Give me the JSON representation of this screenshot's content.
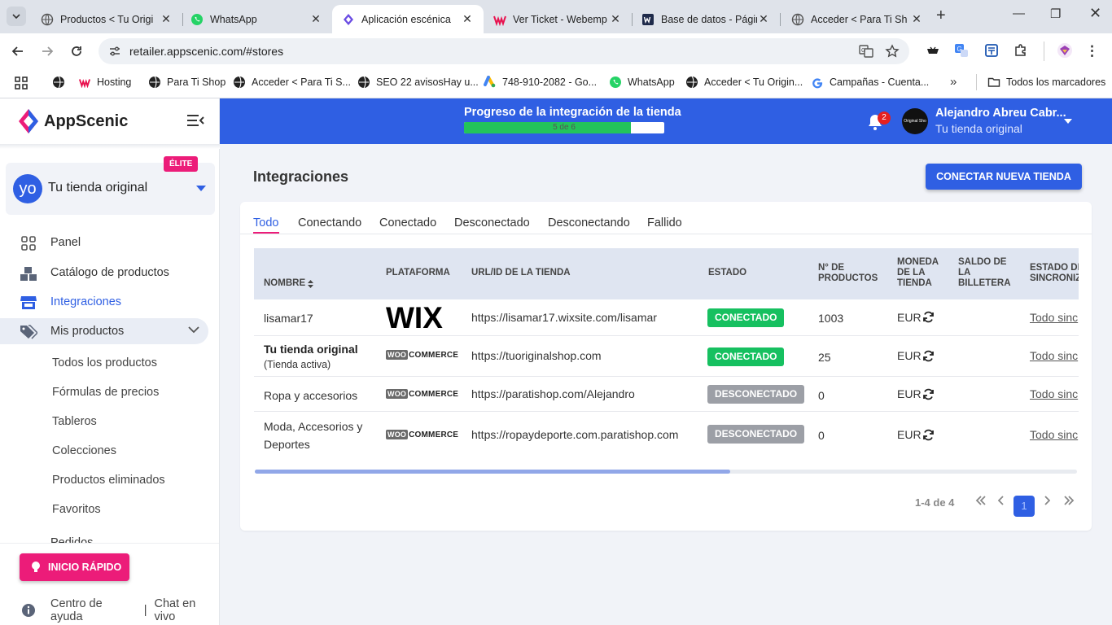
{
  "browser": {
    "tabs": [
      {
        "title": "Productos < Tu Origi",
        "icon": "globe-icon"
      },
      {
        "title": "WhatsApp",
        "icon": "whatsapp-icon"
      },
      {
        "title": "Aplicación escénica",
        "icon": "appscenic-icon",
        "active": true
      },
      {
        "title": "Ver Ticket - Webemp",
        "icon": "webempresa-icon"
      },
      {
        "title": "Base de datos - Págir",
        "icon": "database-icon"
      },
      {
        "title": "Acceder < Para Ti Sh",
        "icon": "globe-icon"
      }
    ],
    "url": "retailer.appscenic.com/#stores",
    "bookmarks": [
      {
        "label": "",
        "icon": "globe-icon"
      },
      {
        "label": "Hosting",
        "icon": "webempresa-icon"
      },
      {
        "label": "Para Ti Shop",
        "icon": "globe-icon"
      },
      {
        "label": "Acceder < Para Ti S...",
        "icon": "globe-icon"
      },
      {
        "label": "SEO 22 avisosHay u...",
        "icon": "globe-icon"
      },
      {
        "label": "748-910-2082 - Go...",
        "icon": "google-ads-icon"
      },
      {
        "label": "WhatsApp",
        "icon": "whatsapp-icon"
      },
      {
        "label": "Acceder < Tu Origin...",
        "icon": "globe-icon"
      },
      {
        "label": "Campañas - Cuenta...",
        "icon": "google-icon"
      }
    ],
    "all_bookmarks": "Todos los marcadores"
  },
  "sidebar": {
    "brand": "AppScenic",
    "store": {
      "avatar": "yo",
      "name": "Tu tienda original",
      "badge": "ÉLITE"
    },
    "nav": [
      {
        "label": "Panel",
        "icon": "dashboard-icon"
      },
      {
        "label": "Catálogo de productos",
        "icon": "boxes-icon"
      },
      {
        "label": "Integraciones",
        "icon": "store-icon",
        "active": true
      },
      {
        "label": "Mis productos",
        "icon": "tags-icon",
        "expanded": true
      }
    ],
    "subnav": [
      "Todos los productos",
      "Fórmulas de precios",
      "Tableros",
      "Colecciones",
      "Productos eliminados",
      "Favoritos",
      "Pedidos"
    ],
    "quick_start": "INICIO RÁPIDO",
    "help": "Centro de ayuda",
    "help_sep": "|",
    "chat": "Chat en vivo"
  },
  "topbar": {
    "progress_title": "Progreso de la integración de la tienda",
    "progress_label": "5 de 6",
    "progress_fraction": 0.833,
    "notifications": "2",
    "user_name": "Alejandro Abreu Cabr...",
    "user_store": "Tu tienda original",
    "avatar_text": "Original Sho"
  },
  "main": {
    "title": "Integraciones",
    "connect_button": "CONECTAR NUEVA TIENDA",
    "filter_tabs": [
      "Todo",
      "Conectando",
      "Conectado",
      "Desconectado",
      "Desconectando",
      "Fallido"
    ],
    "columns": {
      "name": "NOMBRE",
      "platform": "PLATAFORMA",
      "url": "URL/ID DE LA TIENDA",
      "status": "ESTADO",
      "products": [
        "N° DE",
        "PRODUCTOS"
      ],
      "currency": [
        "MONEDA",
        "DE LA",
        "TIENDA"
      ],
      "wallet": [
        "SALDO DE",
        "LA",
        "BILLETERA"
      ],
      "sync": [
        "ESTADO DE",
        "SINCRONIZ"
      ]
    },
    "rows": [
      {
        "name": "lisamar17",
        "sub": "",
        "platform": "WIX",
        "url": "https://lisamar17.wixsite.com/lisamar",
        "status": "CONECTADO",
        "connected": true,
        "products": "1003",
        "currency": "EUR",
        "sync": "Todo sinc"
      },
      {
        "name": "Tu tienda original",
        "sub": "(Tienda activa)",
        "platform": "WOOCOMMERCE",
        "url": "https://tuoriginalshop.com",
        "status": "CONECTADO",
        "connected": true,
        "products": "25",
        "currency": "EUR",
        "sync": "Todo sinc"
      },
      {
        "name": "Ropa y accesorios",
        "sub": "",
        "platform": "WOOCOMMERCE",
        "url": "https://paratishop.com/Alejandro",
        "status": "DESCONECTADO",
        "connected": false,
        "products": "0",
        "currency": "EUR",
        "sync": "Todo sinc"
      },
      {
        "name": "Moda, Accesorios y",
        "name2": "Deportes",
        "sub": "",
        "platform": "WOOCOMMERCE",
        "url": "https://ropaydeporte.com.paratishop.com",
        "status": "DESCONECTADO",
        "connected": false,
        "products": "0",
        "currency": "EUR",
        "sync": "Todo sinc"
      }
    ],
    "woo_parts": {
      "woo": "WOO",
      "commerce": "COMMERCE"
    },
    "pagination": {
      "summary": "1-4 de 4",
      "current": "1"
    }
  },
  "colors": {
    "primary": "#2f5fe3",
    "accent": "#ec1c79",
    "success": "#16c060",
    "muted": "#9c9fa6"
  }
}
